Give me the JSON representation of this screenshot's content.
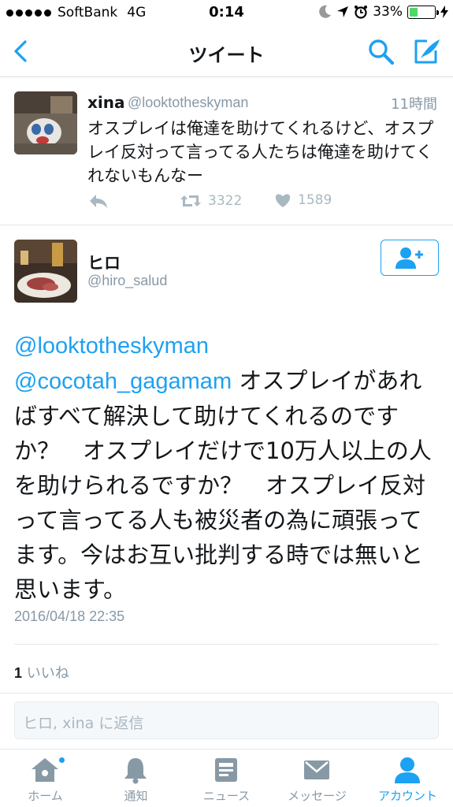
{
  "status_bar": {
    "carrier": "SoftBank",
    "network": "4G",
    "time": "0:14",
    "battery": "33%",
    "battery_level": 0.33
  },
  "nav": {
    "title": "ツイート"
  },
  "tweet1": {
    "name": "xina",
    "handle": "@looktotheskyman",
    "time": "11時間",
    "text": "オスプレイは俺達を助けてくれるけど、オスプレイ反対って言ってる人たちは俺達を助けてくれないもんなー",
    "retweets": "3322",
    "likes": "1589"
  },
  "tweet2": {
    "name": "ヒロ",
    "handle": "@hiro_salud",
    "mention1": "@looktotheskyman",
    "mention2": "@cocotah_gagamam",
    "text": " オスプレイがあればすべて解決して助けてくれるのですか？　オスプレイだけで10万人以上の人を助けられるですか？　オスプレイ反対って言ってる人も被災者の為に頑張ってます。今はお互い批判する時では無いと思います。",
    "date": "2016/04/18 22:35",
    "like_count": "1",
    "like_label": "いいね"
  },
  "reply": {
    "placeholder": "ヒロ, xina に返信"
  },
  "tabs": [
    {
      "label": "ホーム",
      "icon": "home-icon"
    },
    {
      "label": "通知",
      "icon": "bell-icon"
    },
    {
      "label": "ニュース",
      "icon": "news-icon"
    },
    {
      "label": "メッセージ",
      "icon": "envelope-icon"
    },
    {
      "label": "アカウント",
      "icon": "person-icon"
    }
  ],
  "colors": {
    "accent": "#1da1f2",
    "muted": "#8899a6"
  }
}
